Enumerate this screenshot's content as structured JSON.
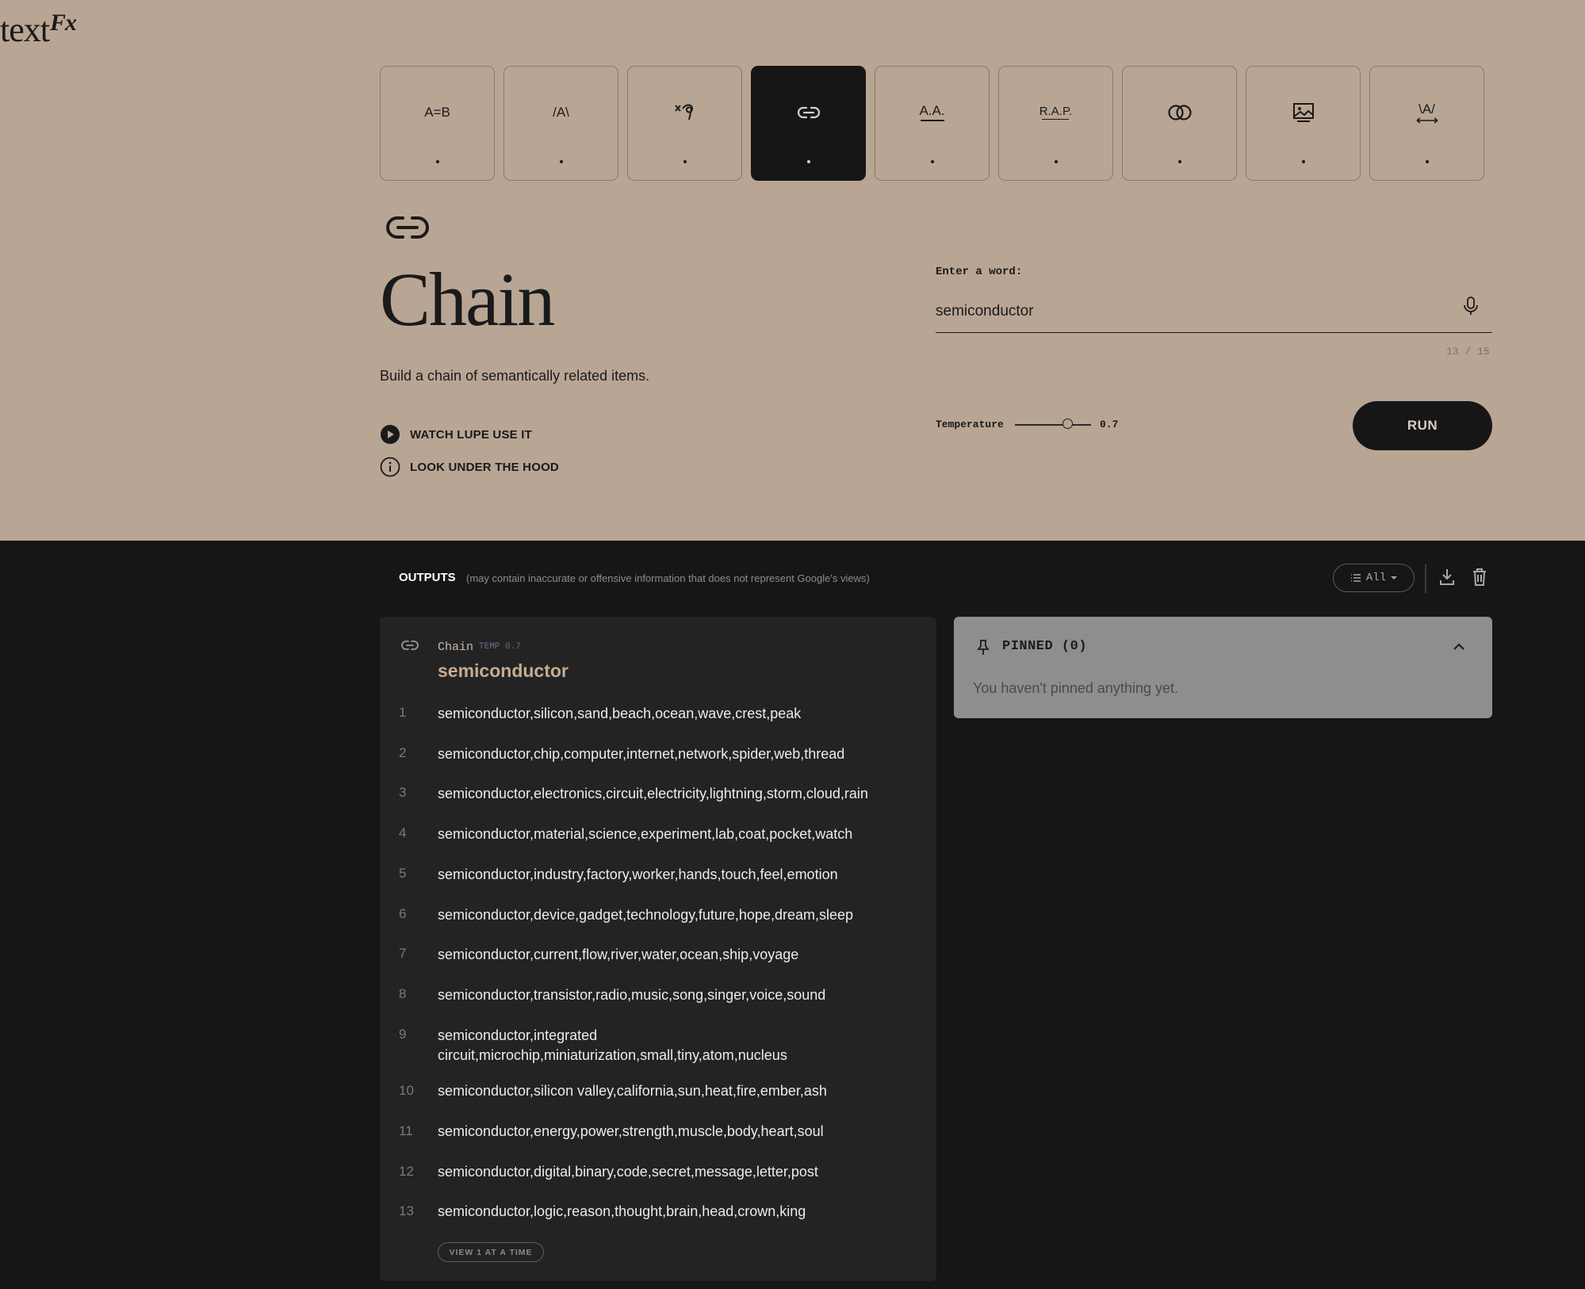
{
  "app": {
    "logo_text": "text",
    "logo_mark": "Fx"
  },
  "tools": [
    {
      "label": "A=B",
      "icon": "simile-icon",
      "active": false
    },
    {
      "label": "/A\\",
      "icon": "explode-icon",
      "active": false
    },
    {
      "label": "",
      "icon": "unexpect-icon",
      "active": false
    },
    {
      "label": "",
      "icon": "chain-icon",
      "active": true
    },
    {
      "label": "A.A.",
      "icon": "acronym-icon",
      "active": false
    },
    {
      "label": "R.A.P.",
      "icon": "rap-icon",
      "active": false
    },
    {
      "label": "",
      "icon": "fuse-icon",
      "active": false
    },
    {
      "label": "",
      "icon": "scene-icon",
      "active": false
    },
    {
      "label": "\\A/",
      "icon": "unfold-icon",
      "active": false
    }
  ],
  "main": {
    "title": "Chain",
    "description": "Build a chain of semantically related items.",
    "watch_label": "WATCH LUPE USE IT",
    "hood_label": "LOOK UNDER THE HOOD",
    "input_label": "Enter a word:",
    "input_value": "semiconductor",
    "char_count": "13 / 15",
    "temperature_label": "Temperature",
    "temperature_value": "0.7",
    "temperature_fraction": 0.7,
    "run_label": "RUN"
  },
  "outputs": {
    "heading": "OUTPUTS",
    "disclaimer": "(may contain inaccurate or offensive information that does not represent Google's views)",
    "filter_label": "All",
    "card": {
      "tool_name": "Chain",
      "temp_label": "TEMP 0.7",
      "word": "semiconductor",
      "results": [
        {
          "num": "1",
          "text": "semiconductor,silicon,sand,beach,ocean,wave,crest,peak"
        },
        {
          "num": "2",
          "text": "semiconductor,chip,computer,internet,network,spider,web,thread"
        },
        {
          "num": "3",
          "text": "semiconductor,electronics,circuit,electricity,lightning,storm,cloud,rain"
        },
        {
          "num": "4",
          "text": "semiconductor,material,science,experiment,lab,coat,pocket,watch"
        },
        {
          "num": "5",
          "text": "semiconductor,industry,factory,worker,hands,touch,feel,emotion"
        },
        {
          "num": "6",
          "text": "semiconductor,device,gadget,technology,future,hope,dream,sleep"
        },
        {
          "num": "7",
          "text": "semiconductor,current,flow,river,water,ocean,ship,voyage"
        },
        {
          "num": "8",
          "text": "semiconductor,transistor,radio,music,song,singer,voice,sound"
        },
        {
          "num": "9",
          "text": "semiconductor,integrated circuit,microchip,miniaturization,small,tiny,atom,nucleus"
        },
        {
          "num": "10",
          "text": "semiconductor,silicon valley,california,sun,heat,fire,ember,ash"
        },
        {
          "num": "11",
          "text": "semiconductor,energy,power,strength,muscle,body,heart,soul"
        },
        {
          "num": "12",
          "text": "semiconductor,digital,binary,code,secret,message,letter,post"
        },
        {
          "num": "13",
          "text": "semiconductor,logic,reason,thought,brain,head,crown,king"
        }
      ],
      "view_button_label": "VIEW 1 AT A TIME"
    },
    "pinned": {
      "title": "PINNED (0)",
      "empty_text": "You haven't pinned anything yet."
    }
  },
  "colors": {
    "header_bg": "#b9a594",
    "page_bg": "#161616",
    "card_bg": "#232323",
    "pinned_bg": "#8e8e8e",
    "accent": "#c8ab91"
  }
}
